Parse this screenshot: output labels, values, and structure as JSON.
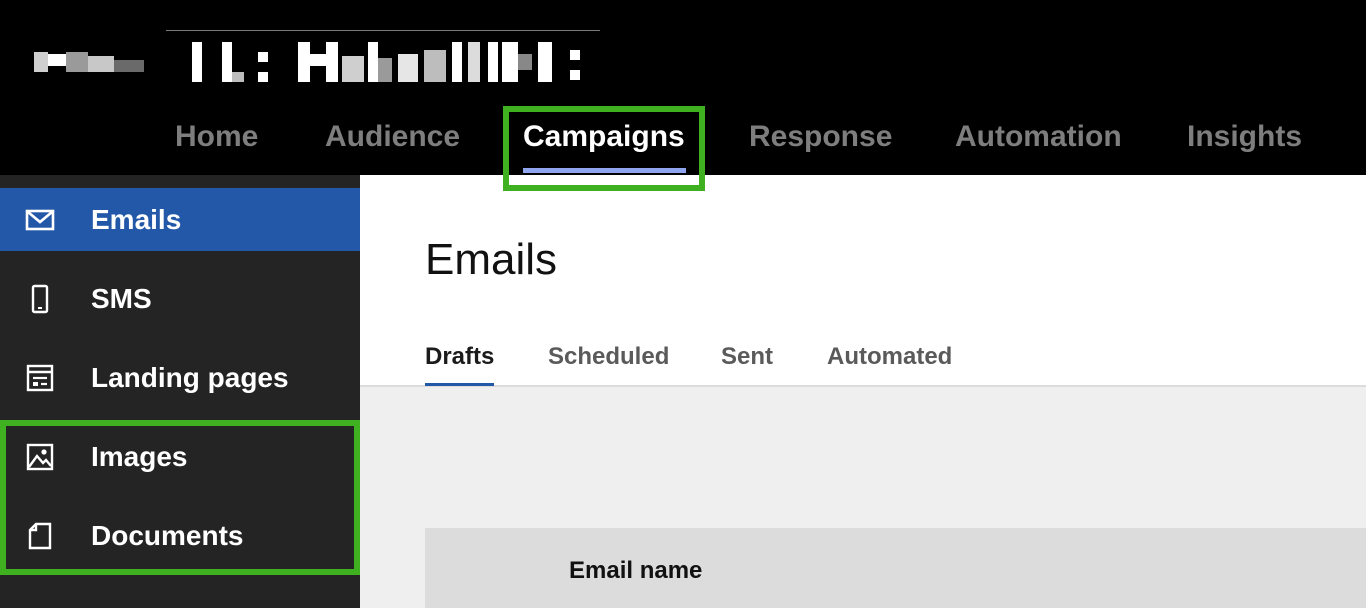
{
  "top_nav": {
    "items": [
      {
        "label": "Home",
        "active": false
      },
      {
        "label": "Audience",
        "active": false
      },
      {
        "label": "Campaigns",
        "active": true
      },
      {
        "label": "Response",
        "active": false
      },
      {
        "label": "Automation",
        "active": false
      },
      {
        "label": "Insights",
        "active": false
      }
    ]
  },
  "sidebar": {
    "items": [
      {
        "label": "Emails",
        "icon": "envelope-icon",
        "active": true
      },
      {
        "label": "SMS",
        "icon": "mobile-phone-icon",
        "active": false
      },
      {
        "label": "Landing pages",
        "icon": "landing-page-icon",
        "active": false
      },
      {
        "label": "Images",
        "icon": "image-icon",
        "active": false
      },
      {
        "label": "Documents",
        "icon": "document-icon",
        "active": false
      }
    ]
  },
  "main": {
    "title": "Emails",
    "tabs": [
      {
        "label": "Drafts",
        "active": true
      },
      {
        "label": "Scheduled",
        "active": false
      },
      {
        "label": "Sent",
        "active": false
      },
      {
        "label": "Automated",
        "active": false
      }
    ],
    "table": {
      "columns": [
        "Email name"
      ]
    }
  },
  "colors": {
    "highlight_box": "#3fb020",
    "active_sidebar": "#2358a8",
    "active_nav_underline": "#8fa5ef",
    "sidebar_bg": "#242424"
  }
}
